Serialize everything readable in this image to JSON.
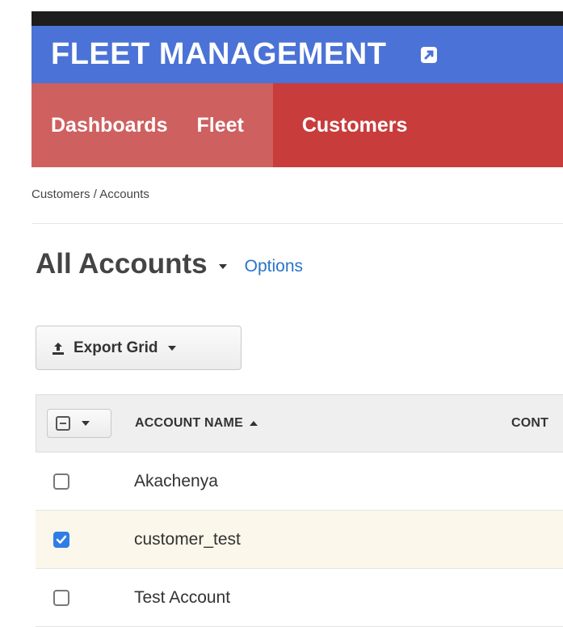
{
  "app": {
    "title": "FLEET MANAGEMENT",
    "external_icon": "external-link-icon"
  },
  "nav": {
    "items": [
      {
        "label": "Dashboards",
        "active": false
      },
      {
        "label": "Fleet",
        "active": false
      },
      {
        "label": "Customers",
        "active": true
      }
    ]
  },
  "breadcrumb": {
    "parent": "Customers",
    "separator": " / ",
    "current": "Accounts"
  },
  "page": {
    "title": "All Accounts",
    "options_label": "Options"
  },
  "toolbar": {
    "export_label": "Export Grid",
    "export_icon": "upload-icon"
  },
  "grid": {
    "columns": [
      "ACCOUNT NAME",
      "CONT"
    ],
    "sort": {
      "column": "ACCOUNT NAME",
      "direction": "ascending"
    },
    "rows": [
      {
        "name": "Akachenya",
        "selected": false
      },
      {
        "name": "customer_test",
        "selected": true
      },
      {
        "name": "Test Account",
        "selected": false
      }
    ]
  },
  "colors": {
    "app_bar": "#4b72d6",
    "nav_bar": "#cf6060",
    "nav_active": "#c93c3c",
    "link": "#2a74c9",
    "checkbox_checked": "#2f7ee6",
    "selected_row": "#fbf7ea"
  }
}
